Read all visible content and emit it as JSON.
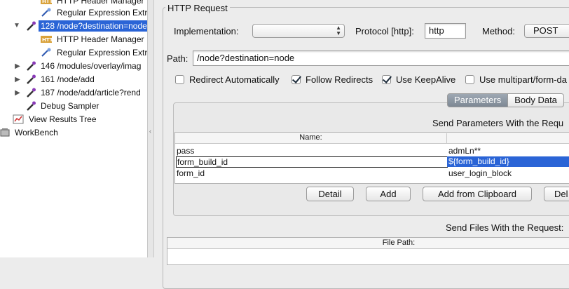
{
  "tree": {
    "items": [
      {
        "label": "HTTP Header Manager",
        "icon": "http-header-icon"
      },
      {
        "label": "Regular Expression Extr",
        "icon": "regex-extractor-icon"
      },
      {
        "label": "128 /node?destination=node",
        "icon": "sampler-pipette-icon",
        "selected": true,
        "expanded": true
      },
      {
        "label": "HTTP Header Manager",
        "icon": "http-header-icon"
      },
      {
        "label": "Regular Expression Extr",
        "icon": "regex-extractor-icon"
      },
      {
        "label": "146 /modules/overlay/imag",
        "icon": "sampler-pipette-icon"
      },
      {
        "label": "161 /node/add",
        "icon": "sampler-pipette-icon"
      },
      {
        "label": "187 /node/add/article?rend",
        "icon": "sampler-pipette-icon"
      },
      {
        "label": "Debug Sampler",
        "icon": "sampler-pipette-icon"
      },
      {
        "label": "View Results Tree",
        "icon": "results-tree-icon"
      },
      {
        "label": "WorkBench",
        "icon": "workbench-icon"
      }
    ]
  },
  "request": {
    "group_title": "HTTP Request",
    "implementation_label": "Implementation:",
    "implementation_value": "",
    "protocol_label": "Protocol [http]:",
    "protocol_value": "http",
    "method_label": "Method:",
    "method_value": "POST",
    "path_label": "Path:",
    "path_value": "/node?destination=node",
    "checkboxes": [
      {
        "label": "Redirect Automatically",
        "checked": false
      },
      {
        "label": "Follow Redirects",
        "checked": true
      },
      {
        "label": "Use KeepAlive",
        "checked": true
      },
      {
        "label": "Use multipart/form-da",
        "checked": false
      }
    ],
    "tabs": [
      {
        "label": "Parameters",
        "active": true
      },
      {
        "label": "Body Data",
        "active": false
      }
    ],
    "params_title": "Send Parameters With the Requ",
    "params_header": "Name:",
    "params": [
      {
        "name": "pass",
        "value": "admLn**"
      },
      {
        "name": "form_build_id",
        "value": "${form_build_id}",
        "editing": true
      },
      {
        "name": "form_id",
        "value": "user_login_block"
      }
    ],
    "buttons": {
      "detail": "Detail",
      "add": "Add",
      "add_clipboard": "Add from Clipboard",
      "delete": "Del"
    },
    "files_title": "Send Files With the Request:",
    "files_header": "File Path:"
  },
  "colors": {
    "selection": "#2a64d6",
    "panel_bg": "#ececec"
  }
}
